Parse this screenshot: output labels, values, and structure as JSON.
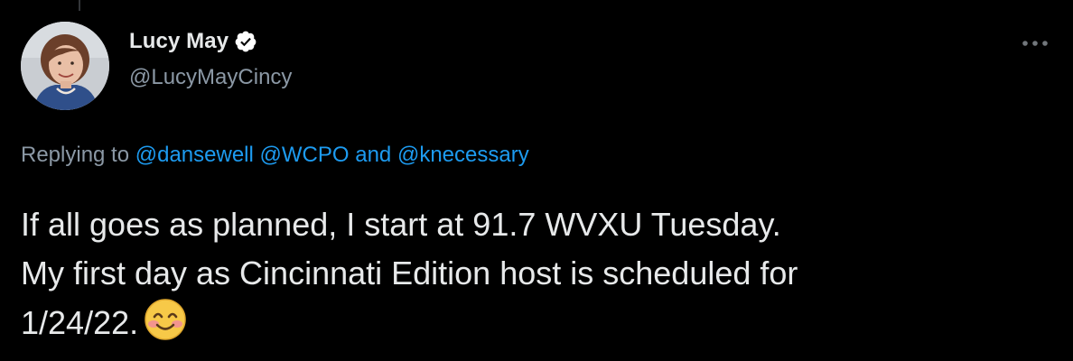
{
  "author": {
    "display_name": "Lucy May",
    "handle": "@LucyMayCincy",
    "verified": true,
    "avatar_icon": "profile-photo"
  },
  "reply_context": {
    "prefix": "Replying to",
    "mention_1": "@dansewell",
    "mention_2": "@WCPO",
    "conjunction": "and",
    "mention_3": "@knecessary"
  },
  "tweet": {
    "line_1": "If all goes as planned, I start at 91.7 WVXU Tuesday.",
    "line_2": "My first day as Cincinnati Edition host is scheduled for",
    "line_3": "1/24/22.",
    "emoji": "smiling-face-with-smiling-eyes"
  },
  "colors": {
    "background": "#000000",
    "text": "#e7e9ea",
    "secondary": "#8b98a5",
    "link": "#1d9bf0"
  },
  "icons": {
    "more": "more-horizontal-icon",
    "verified": "verified-badge-icon"
  }
}
